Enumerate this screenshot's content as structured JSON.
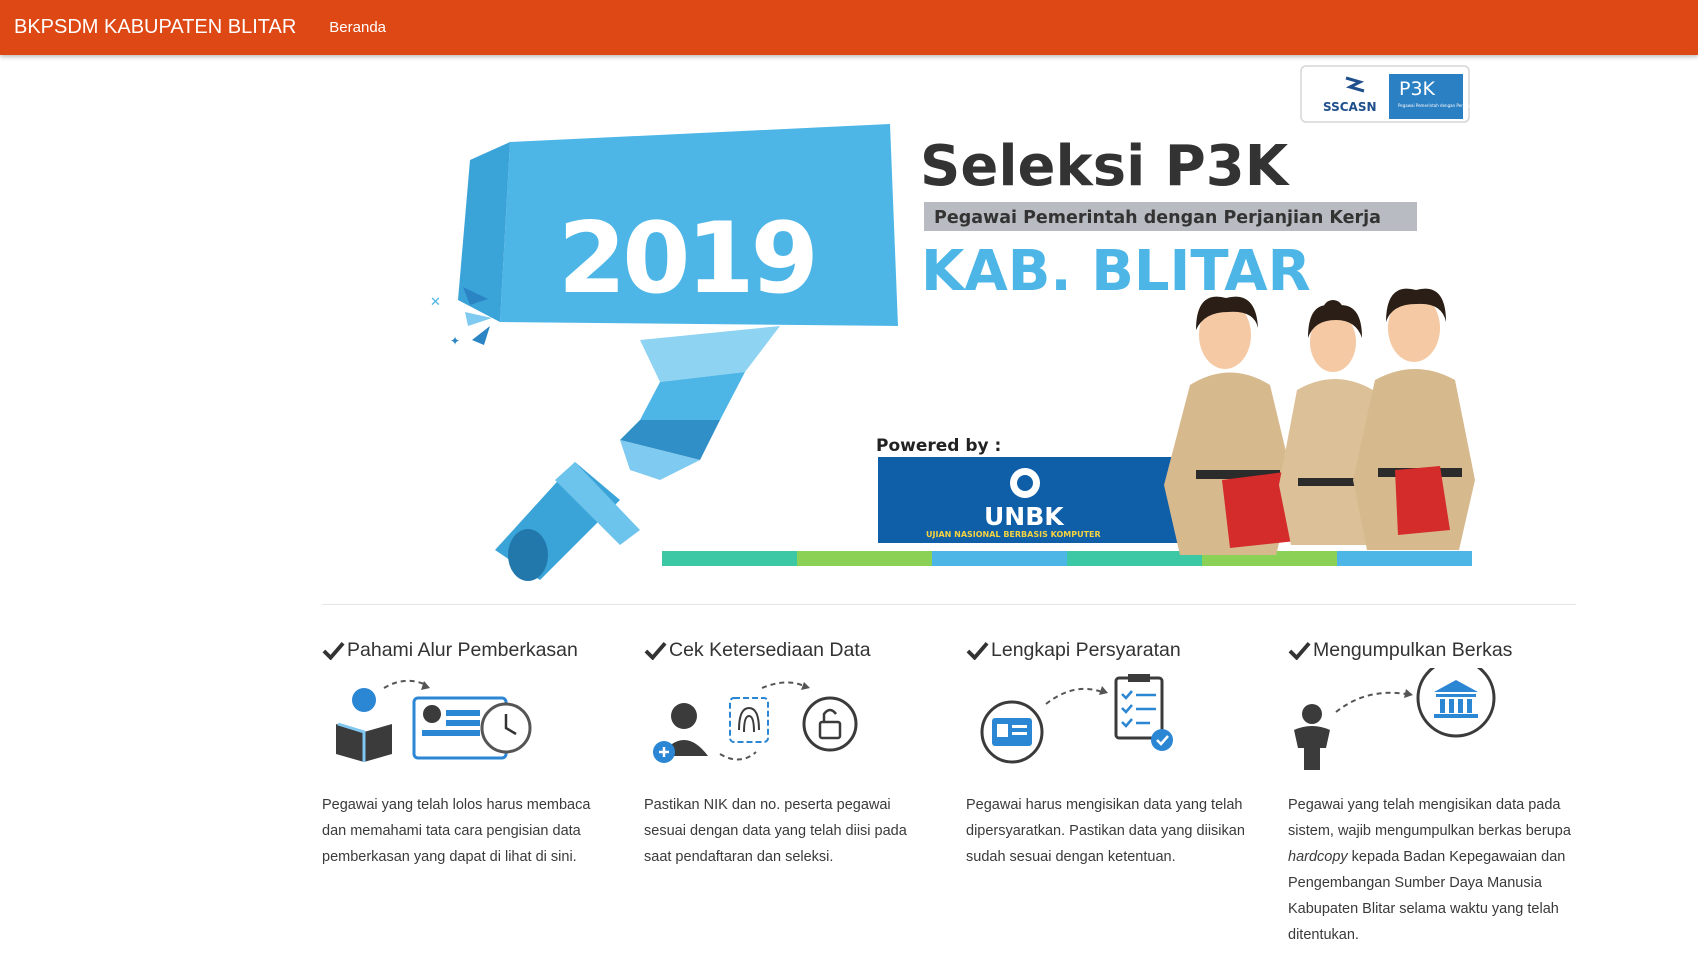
{
  "navbar": {
    "brand": "BKPSDM KABUPATEN BLITAR",
    "links": [
      {
        "label": "Beranda"
      }
    ]
  },
  "banner": {
    "year": "2019",
    "title": "Seleksi P3K",
    "subtitle": "Pegawai Pemerintah dengan Perjanjian Kerja",
    "region": "KAB. BLITAR",
    "powered_by": "Powered by :",
    "unbk_logo": {
      "name": "UNBK",
      "tagline": "UJIAN NASIONAL BERBASIS KOMPUTER"
    },
    "partner_logos": {
      "sscasn": "SSCASN",
      "p3k": "P3K",
      "p3k_caption": "Pegawai Pemerintah dengan Perjanjian Kerja"
    },
    "colors": {
      "accent_blue": "#4db6e6",
      "accent_orange": "#dd4814"
    }
  },
  "steps": [
    {
      "title": "Pahami Alur Pemberkasan",
      "icon": "reader-computer-clock-icon",
      "text": "Pegawai yang telah lolos harus membaca dan memahami tata cara pengisian data pemberkasan yang dapat di lihat di sini."
    },
    {
      "title": "Cek Ketersediaan Data",
      "icon": "user-fingerprint-lock-icon",
      "text": "Pastikan NIK dan no. peserta pegawai sesuai dengan data yang telah diisi pada saat pendaftaran dan seleksi."
    },
    {
      "title": "Lengkapi Persyaratan",
      "icon": "id-card-checklist-icon",
      "text": "Pegawai harus mengisikan data yang telah dipersyaratkan. Pastikan data yang diisikan sudah sesuai dengan ketentuan."
    },
    {
      "title": "Mengumpulkan Berkas",
      "icon": "person-institution-icon",
      "text_before": "Pegawai yang telah mengisikan data pada sistem, wajib mengumpulkan berkas berupa ",
      "text_em": "hardcopy",
      "text_after": " kepada Badan Kepegawaian dan Pengembangan Sumber Daya Manusia Kabupaten Blitar selama waktu yang telah ditentukan."
    }
  ]
}
